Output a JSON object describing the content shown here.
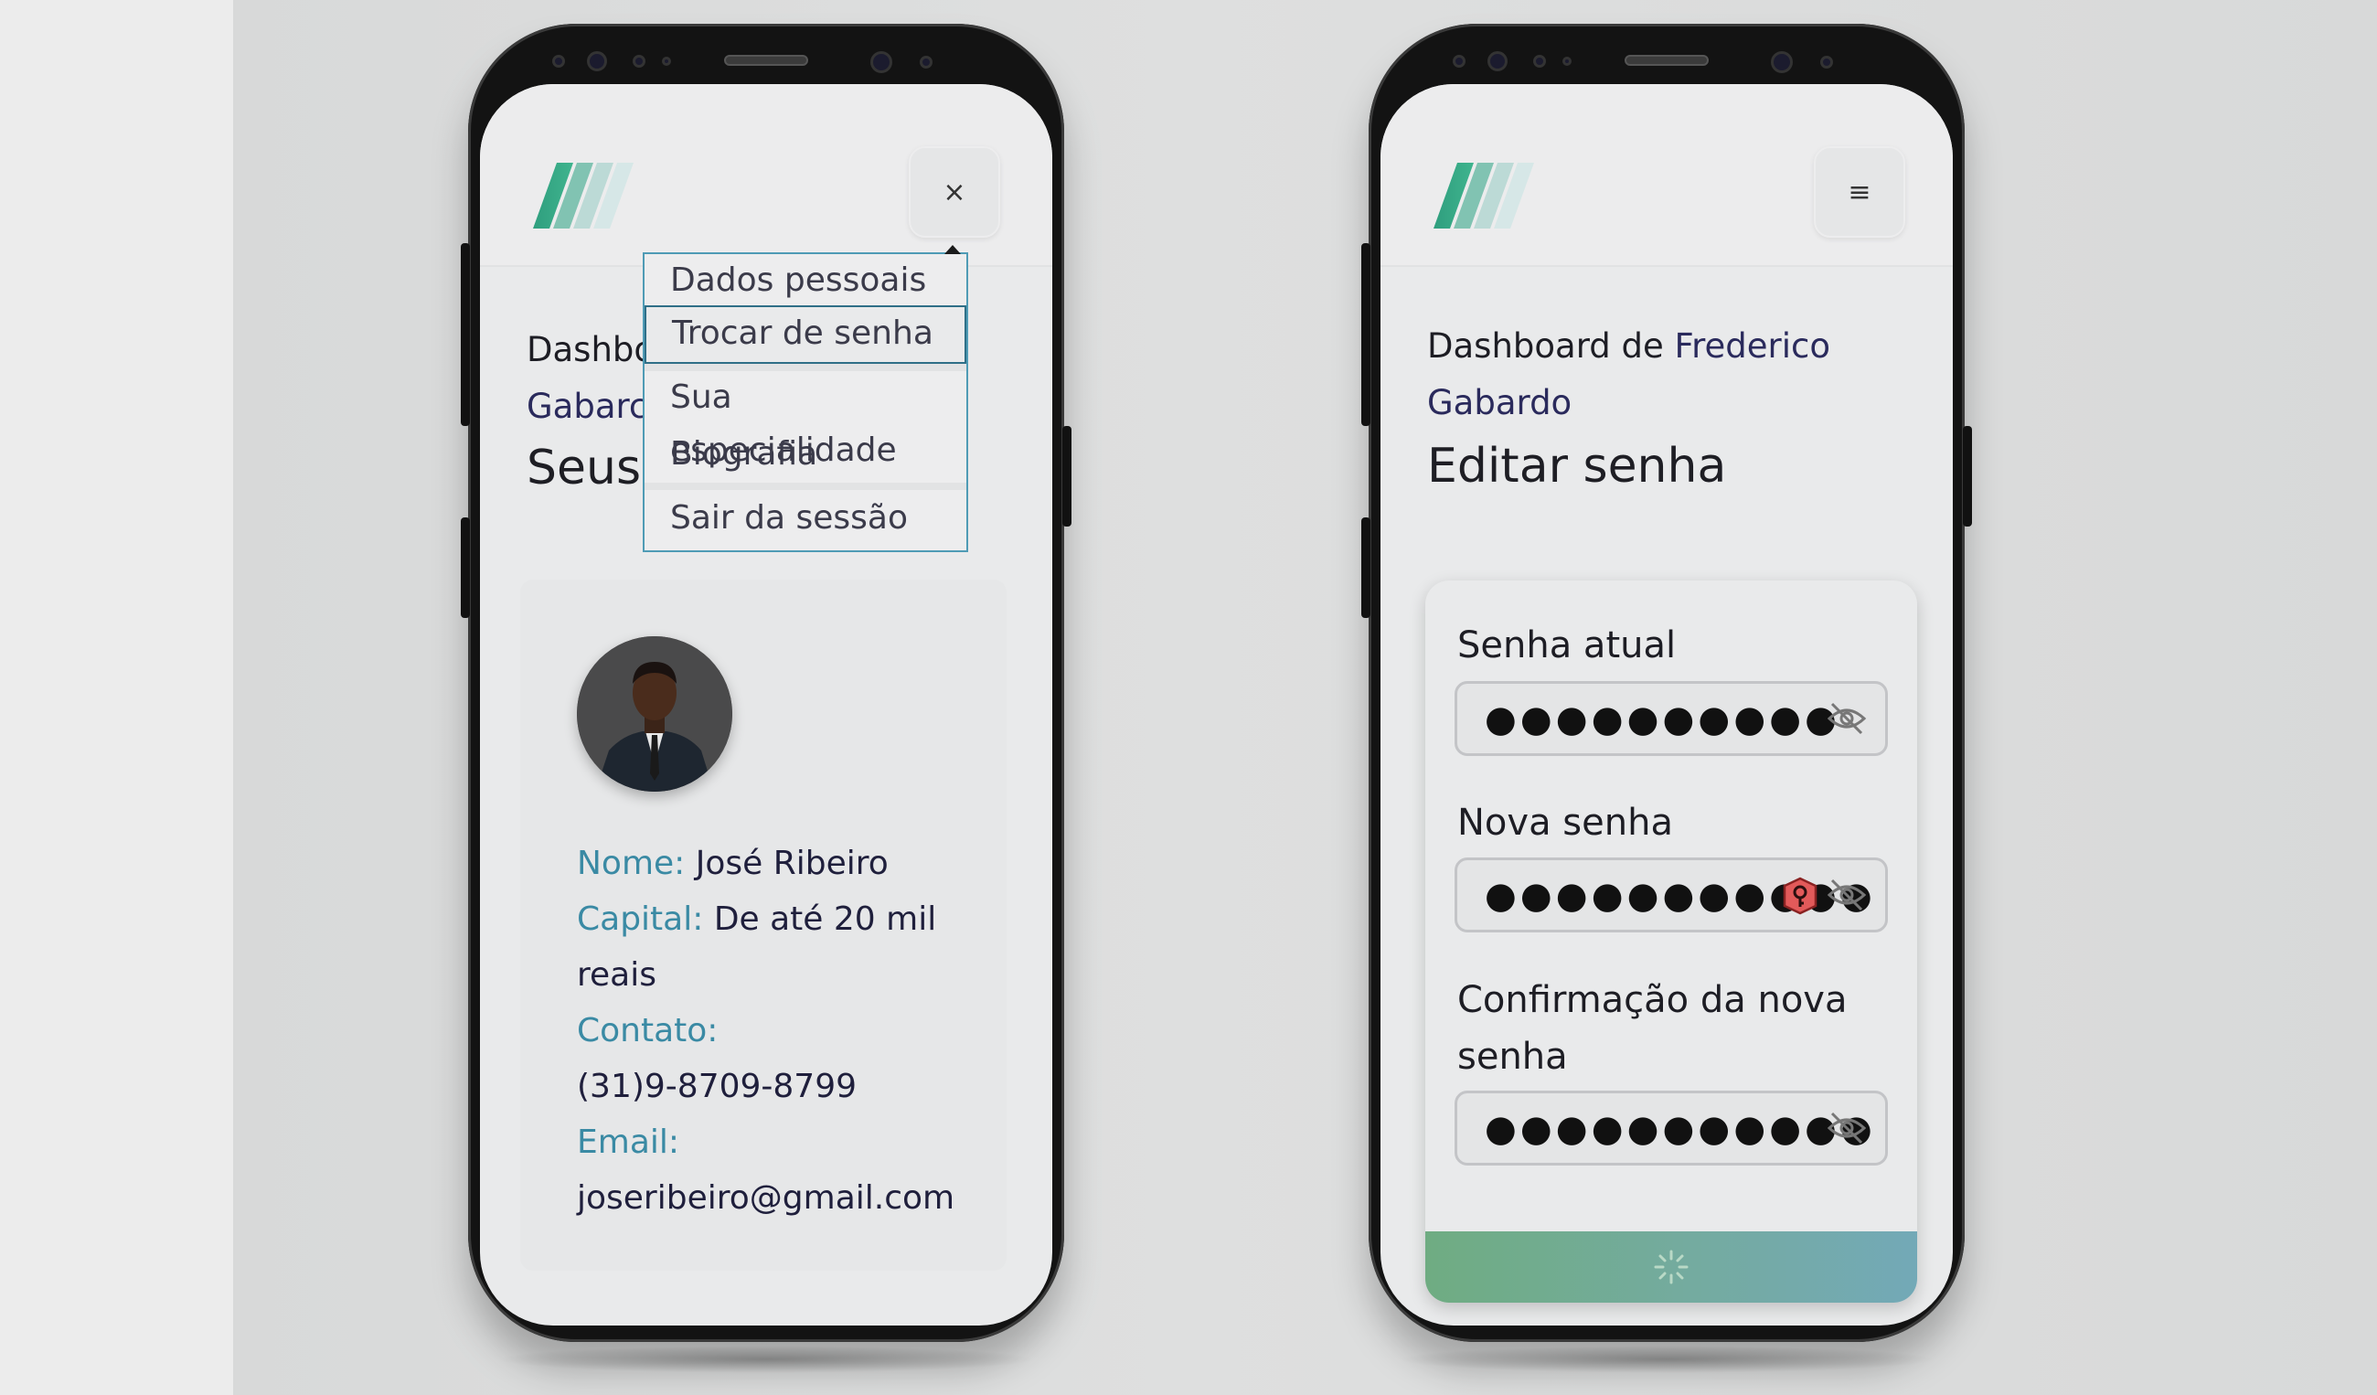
{
  "left_screen": {
    "close_label": "×",
    "heading_prefix": "Dashbo",
    "heading_name": "Gabarc",
    "title": "Seus",
    "menu": {
      "items": [
        {
          "label": "Dados pessoais"
        },
        {
          "label": "Trocar de senha"
        },
        {
          "label": "Sua especialidade"
        },
        {
          "label": "Biografia"
        },
        {
          "label": "Sair da sessão"
        }
      ]
    },
    "profile": {
      "name_label": "Nome:",
      "name_value": "José Ribeiro",
      "capital_label": "Capital:",
      "capital_value_1": "De até 20 mil",
      "capital_value_2": "reais",
      "contact_label": "Contato:",
      "contact_value": "(31)9-8709-8799",
      "email_label": "Email:",
      "email_value": "joseribeiro@gmail.com"
    }
  },
  "right_screen": {
    "menu_icon": "≡",
    "heading_prefix": "Dashboard de",
    "heading_name_1": "Frederico",
    "heading_name_2": "Gabardo",
    "title": "Editar senha",
    "form": {
      "current_label": "Senha atual",
      "current_value": "●●●●●●●●●●",
      "new_label": "Nova senha",
      "new_value": "●●●●●●●●●●●",
      "confirm_label_1": "Confirmação da nova",
      "confirm_label_2": "senha",
      "confirm_value": "●●●●●●●●●●●"
    }
  },
  "colors": {
    "accent_teal": "#3a8aa4",
    "dropdown_border": "#4f9bb5",
    "name_color": "#2a2a5c",
    "button_gradient_start": "#6fac82",
    "button_gradient_end": "#73a9b7"
  },
  "icons": [
    "logo-icon",
    "close-icon",
    "menu-icon",
    "eye-off-icon",
    "shield-key-icon",
    "spinner-icon"
  ]
}
